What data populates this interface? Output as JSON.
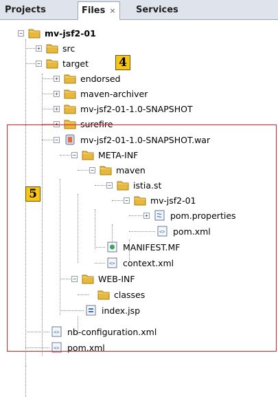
{
  "tabs": [
    {
      "label": "Projects"
    },
    {
      "label": "Files",
      "close": "×"
    },
    {
      "label": "Services"
    }
  ],
  "tree": {
    "root": "mv-jsf2-01",
    "src": "src",
    "target": "target",
    "endorsed": "endorsed",
    "maven_archiver": "maven-archiver",
    "snapshot_dir": "mv-jsf2-01-1.0-SNAPSHOT",
    "surefire": "surefire",
    "war": "mv-jsf2-01-1.0-SNAPSHOT.war",
    "meta_inf": "META-INF",
    "maven": "maven",
    "istia": "istia.st",
    "mvjsf2": "mv-jsf2-01",
    "pom_properties": "pom.properties",
    "pom_xml_inner": "pom.xml",
    "manifest": "MANIFEST.MF",
    "context_xml": "context.xml",
    "web_inf": "WEB-INF",
    "classes": "classes",
    "index_jsp": "index.jsp",
    "nb_config": "nb-configuration.xml",
    "pom_xml": "pom.xml"
  },
  "badges": {
    "b4": "4",
    "b5": "5"
  },
  "colors": {
    "highlight_box": "#e02020",
    "badge_fill": "#f5c518",
    "folder": "#e9b83b"
  }
}
